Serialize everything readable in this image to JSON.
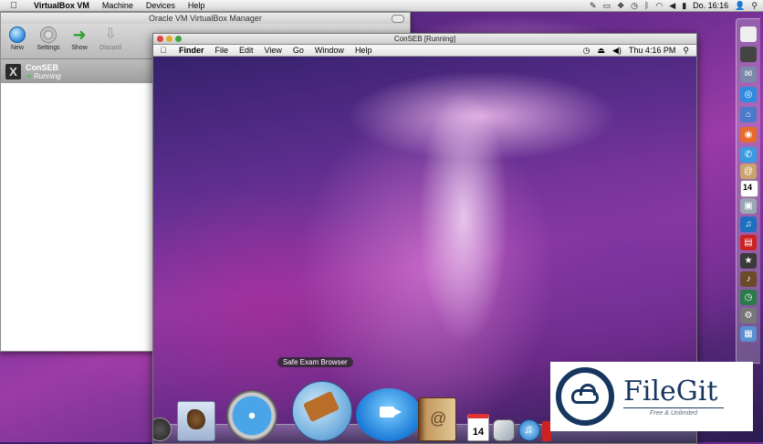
{
  "host_menubar": {
    "apple_icon": "apple-icon",
    "app_name": "VirtualBox VM",
    "menus": [
      "Machine",
      "Devices",
      "Help"
    ],
    "clock": "Do. 16:16"
  },
  "vbox_manager": {
    "title": "Oracle VM VirtualBox Manager",
    "toolbar": {
      "new_label": "New",
      "settings_label": "Settings",
      "show_label": "Show",
      "discard_label": "Discard"
    },
    "vm": {
      "name": "ConSEB",
      "state": "Running"
    }
  },
  "guest": {
    "window_title": "ConSEB [Running]",
    "menubar": {
      "app": "Finder",
      "menus": [
        "File",
        "Edit",
        "View",
        "Go",
        "Window",
        "Help"
      ],
      "clock": "Thu 4:16 PM"
    },
    "dock_tooltip": "Safe Exam Browser",
    "calendar_day": "14"
  },
  "right_dock": {
    "calendar_day": "14"
  },
  "watermark": {
    "brand": "FileGit",
    "tagline": "Free & Unlimited"
  },
  "colors": {
    "accent_blue": "#16365f",
    "running_green": "#4fc04f"
  }
}
